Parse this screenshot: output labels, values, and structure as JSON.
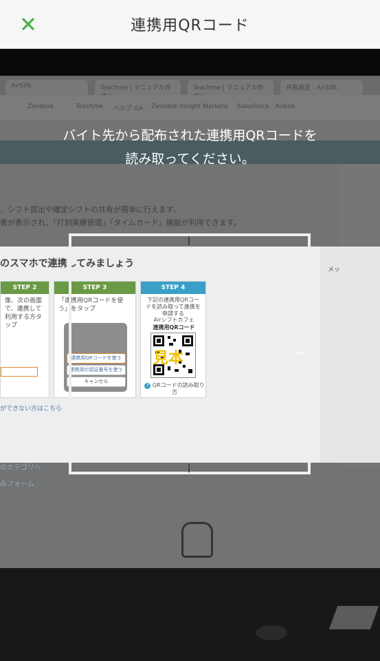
{
  "header": {
    "title": "連携用QRコード",
    "close_icon": "close-icon"
  },
  "scanner": {
    "instruction_line1": "バイト先から配布された連携用QRコードを",
    "instruction_line2": "読み取ってください。",
    "accent_color": "#4caf50"
  },
  "background": {
    "tabs": [
      "AirSifit",
      "Teachme | マニュアル作成ツ",
      "Teachme | マニュアル作成ツ",
      "共有設定 - AirSifit"
    ],
    "bookmarks": [
      "Zendesk",
      "Teachme",
      "ヘルプ GA",
      "Zendesk Insight",
      "Marketo",
      "Salesforce",
      "Airbnb"
    ],
    "page_line1": "、シフト提出や確定シフトの共有が簡単に行えます。",
    "page_line2": "表が表示され、「打刻実績管理」「タイムカード」機能が利用できます。",
    "card_heading": "のスマホで連携してみましょう",
    "step2_title": "STEP 2",
    "step2_text": "像、次の画面で、連携して利用する方タップ",
    "step3_title": "STEP 3",
    "step3_text": "「連携用QRコードを使う」をタップ",
    "step3_btn1": "連携用QRコードを使う",
    "step3_btn2": "連携用の認証番号を使う",
    "step3_btn3": "キャンセル",
    "step4_title": "STEP 4",
    "step4_text": "下記の連携用QRコードを読み取って連携を申請する",
    "step4_store": "Airシフトカフェ",
    "step4_qr_label": "連携用QRコード",
    "qr_watermark": "見本",
    "qr_help": "QRコードの読み取り方",
    "cannot_link": "ができない方はこちら",
    "link1": "のカテゴリへ",
    "link2": "みフォーム",
    "right_panel_label": "メッ"
  }
}
